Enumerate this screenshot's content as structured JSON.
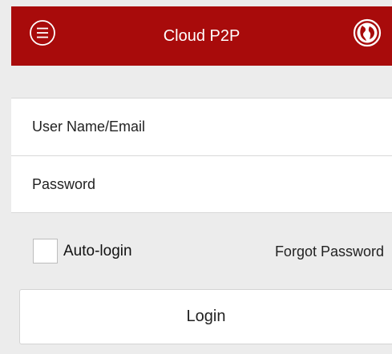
{
  "header": {
    "title": "Cloud P2P",
    "left_icon": "menu-icon",
    "right_icon": "globe-icon",
    "background_color": "#a80b0b",
    "text_color": "#ffffff"
  },
  "form": {
    "username_placeholder": "User Name/Email",
    "username_value": "",
    "password_placeholder": "Password",
    "password_value": ""
  },
  "options": {
    "auto_login_label": "Auto-login",
    "auto_login_checked": false,
    "forgot_password_label": "Forgot Password"
  },
  "actions": {
    "login_label": "Login"
  }
}
